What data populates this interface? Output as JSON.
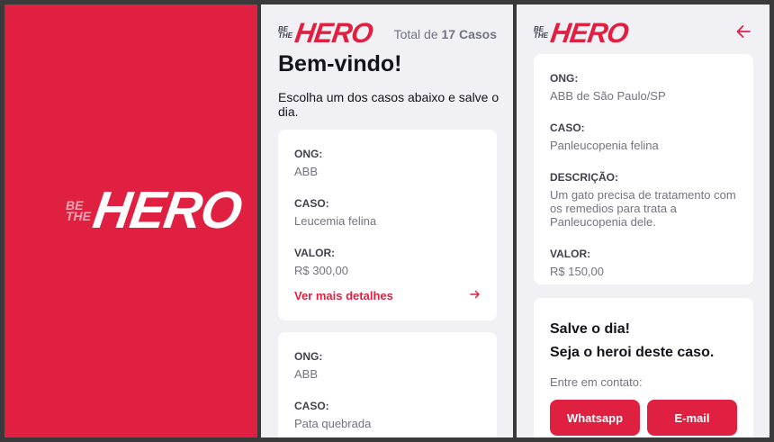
{
  "logo": {
    "be": "BE",
    "the": "THE",
    "hero": "HERO"
  },
  "list": {
    "total_prefix": "Total de",
    "total_count": "17 Casos",
    "title": "Bem-vindo!",
    "subtitle": "Escolha um dos casos abaixo e salve o dia.",
    "cases": [
      {
        "ong_label": "ONG:",
        "ong": "ABB",
        "case_label": "CASO:",
        "case": "Leucemia felina",
        "value_label": "VALOR:",
        "value": "R$ 300,00",
        "details_label": "Ver mais detalhes"
      },
      {
        "ong_label": "ONG:",
        "ong": "ABB",
        "case_label": "CASO:",
        "case": "Pata quebrada"
      }
    ]
  },
  "detail": {
    "ong_label": "ONG:",
    "ong": "ABB de São Paulo/SP",
    "case_label": "CASO:",
    "case": "Panleucopenia felina",
    "description_label": "DESCRIÇÃO:",
    "description": "Um gato precisa de tratamento com os remedios para trata a Panleucopenia dele.",
    "value_label": "VALOR:",
    "value": "R$ 150,00",
    "cta_title_1": "Salve o dia!",
    "cta_title_2": "Seja o heroi deste caso.",
    "cta_subtitle": "Entre em contato:",
    "whatsapp_label": "Whatsapp",
    "email_label": "E-mail"
  },
  "colors": {
    "brand": "#e02041",
    "background": "#f0f0f5"
  }
}
